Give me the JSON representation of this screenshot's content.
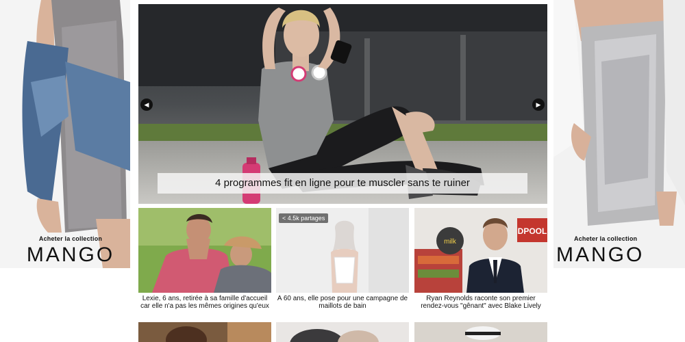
{
  "left_ad": {
    "cta": "Acheter la collection",
    "brand": "MANGO"
  },
  "right_ad": {
    "cta": "Acheter la collection",
    "brand": "MANGO"
  },
  "hero": {
    "caption": "4 programmes fit en ligne pour te muscler sans te ruiner",
    "prev_icon": "chevron-left-icon",
    "next_icon": "chevron-right-icon"
  },
  "cards": [
    {
      "title": "Lexie, 6 ans, retirée à sa famille d'accueil car elle n'a pas les mêmes origines qu'eux"
    },
    {
      "title": "A 60 ans, elle pose pour une campagne de maillots de bain",
      "share_count": "4.5k partages",
      "share_icon": "share-icon"
    },
    {
      "title": "Ryan Reynolds raconte son premier rendez-vous \"gênant\" avec Blake Lively",
      "sign_text": "milk",
      "sign_text2": "DPOOL"
    }
  ]
}
